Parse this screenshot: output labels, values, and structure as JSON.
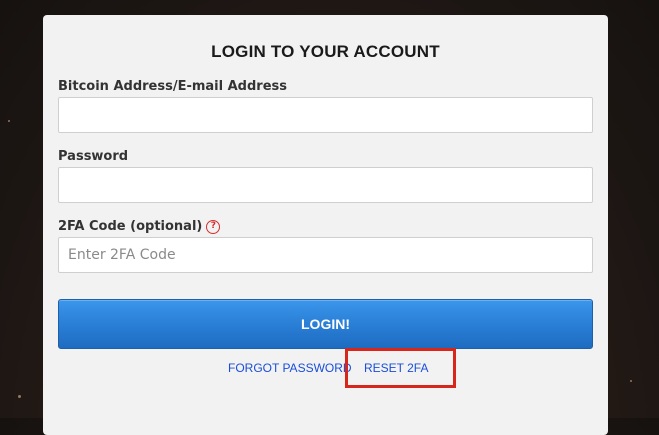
{
  "form": {
    "title": "LOGIN TO YOUR ACCOUNT",
    "fields": [
      {
        "label": "Bitcoin Address/E-mail Address",
        "value": "",
        "placeholder": ""
      },
      {
        "label": "Password",
        "value": "",
        "placeholder": ""
      },
      {
        "label": "2FA Code (optional)",
        "value": "",
        "placeholder": "Enter 2FA Code"
      }
    ],
    "help_icon_glyph": "?",
    "login_button_label": "LOGIN!",
    "links": {
      "forgot_password": "FORGOT PASSWORD",
      "reset_2fa": "RESET 2FA"
    }
  },
  "icons": {
    "help": "question-circle-icon"
  },
  "colors": {
    "button_blue": "#2a7fd6",
    "link_blue": "#1a4ed8",
    "highlight_red": "#d7261b",
    "card_background": "#f2f2f2"
  }
}
